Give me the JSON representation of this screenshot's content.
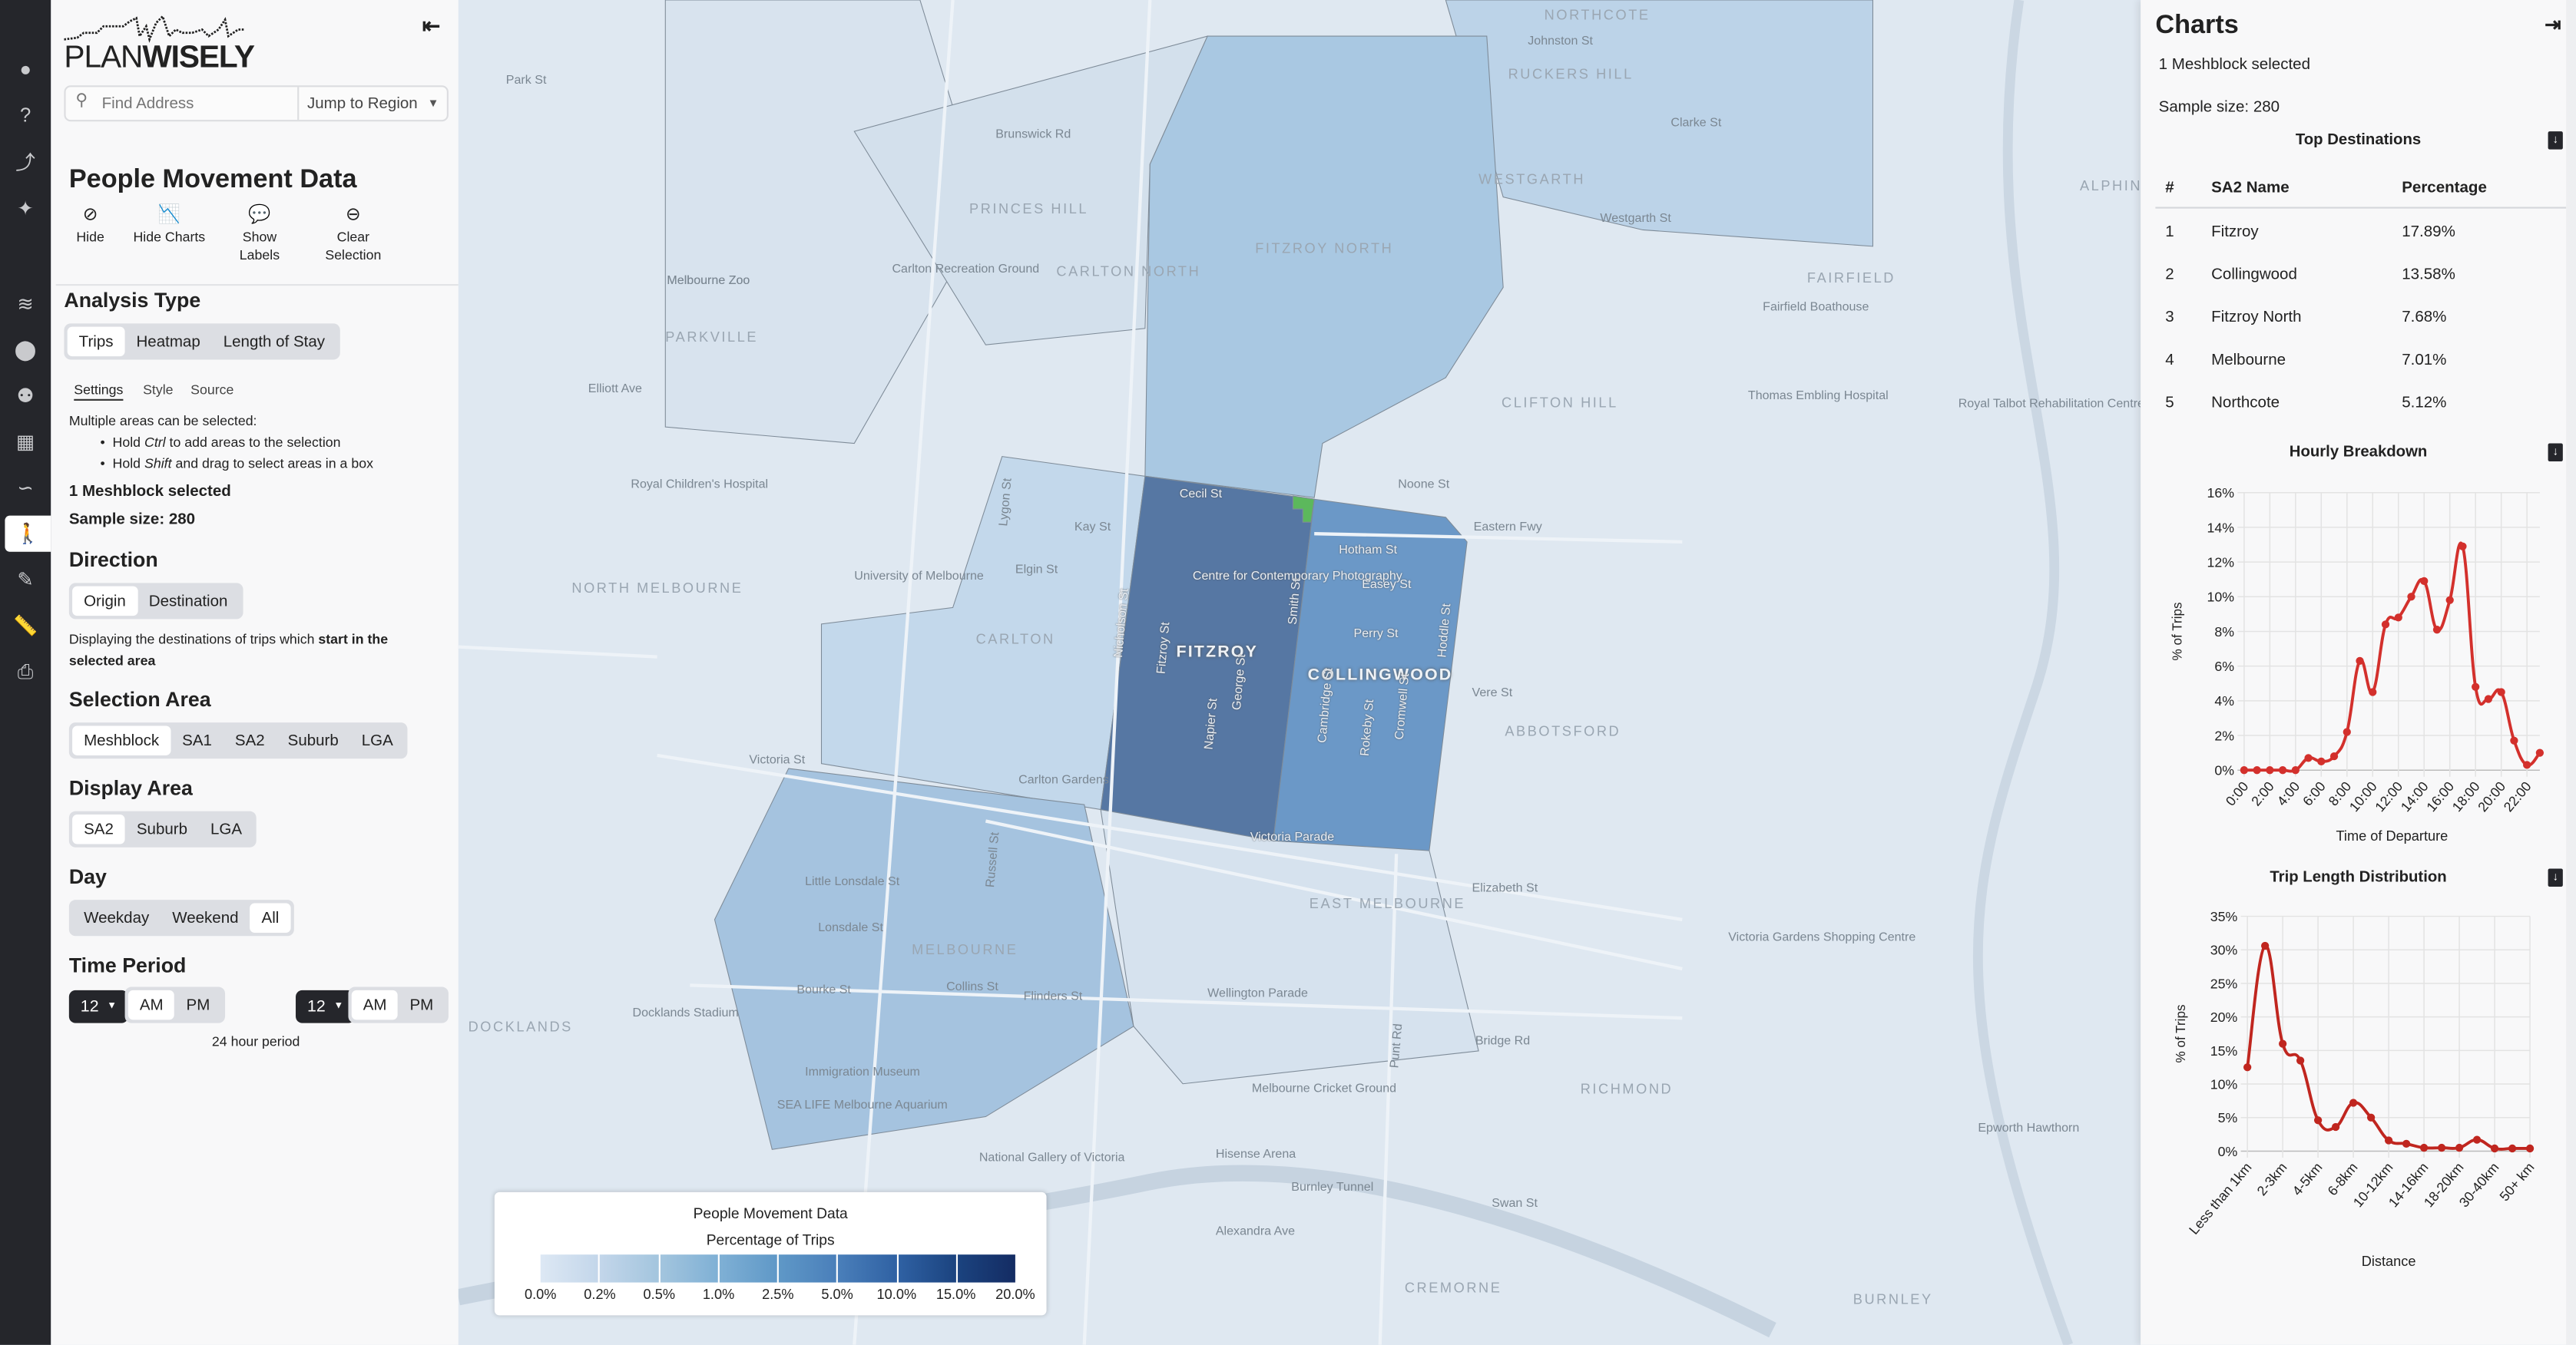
{
  "sidebar": {
    "items": [
      {
        "icon": "user-icon",
        "glyph": "●"
      },
      {
        "icon": "help-icon",
        "glyph": "?"
      },
      {
        "icon": "share-icon",
        "glyph": "⤴"
      },
      {
        "icon": "sparkles-icon",
        "glyph": "✦"
      },
      {
        "icon": "layers-icon",
        "glyph": "≋"
      },
      {
        "icon": "map-pin-icon",
        "glyph": "⬤"
      },
      {
        "icon": "users-icon",
        "glyph": "⚉"
      },
      {
        "icon": "map-location-icon",
        "glyph": "▦"
      },
      {
        "icon": "route-icon",
        "glyph": "∽"
      },
      {
        "icon": "walking-person-icon",
        "glyph": "🚶"
      },
      {
        "icon": "pencil-icon",
        "glyph": "✎"
      },
      {
        "icon": "ruler-icon",
        "glyph": "📏"
      },
      {
        "icon": "print-icon",
        "glyph": "⎙"
      }
    ],
    "active_index": 9
  },
  "logo": {
    "text_light": "PLAN",
    "text_bold": "WISELY"
  },
  "search": {
    "placeholder": "Find Address",
    "jump_label": "Jump to Region"
  },
  "panel": {
    "title": "People Movement Data",
    "actions": [
      {
        "label": "Hide",
        "icon": "eye-slash-icon"
      },
      {
        "label": "Hide Charts",
        "icon": "chart-area-icon"
      },
      {
        "label": "Show Labels",
        "icon": "comment-icon"
      },
      {
        "label": "Clear Selection",
        "icon": "minus-circle-icon"
      }
    ],
    "analysis_type": {
      "heading": "Analysis Type",
      "options": [
        "Trips",
        "Heatmap",
        "Length of Stay"
      ],
      "selected": "Trips"
    },
    "subtabs": {
      "options": [
        "Settings",
        "Style",
        "Source"
      ],
      "selected": "Settings"
    },
    "help": {
      "intro": "Multiple areas can be selected:",
      "b1_pre": "Hold ",
      "b1_key": "Ctrl",
      "b1_post": " to add areas to the selection",
      "b2_pre": "Hold ",
      "b2_key": "Shift",
      "b2_post": " and drag to select areas in a box"
    },
    "selected_count": "1 Meshblock selected",
    "sample_size": "Sample size: 280",
    "direction": {
      "heading": "Direction",
      "options": [
        "Origin",
        "Destination"
      ],
      "selected": "Origin",
      "desc_pre": "Displaying the destinations of trips which ",
      "desc_bold": "start in the selected area"
    },
    "selection_area": {
      "heading": "Selection Area",
      "options": [
        "Meshblock",
        "SA1",
        "SA2",
        "Suburb",
        "LGA"
      ],
      "selected": "Meshblock"
    },
    "display_area": {
      "heading": "Display Area",
      "options": [
        "SA2",
        "Suburb",
        "LGA"
      ],
      "selected": "SA2"
    },
    "day": {
      "heading": "Day",
      "options": [
        "Weekday",
        "Weekend",
        "All"
      ],
      "selected": "All"
    },
    "time_period": {
      "heading": "Time Period",
      "start_hour": "12",
      "start_ampm": "AM",
      "end_hour": "12",
      "end_ampm": "AM",
      "am": "AM",
      "pm": "PM",
      "note": "24 hour period"
    }
  },
  "map": {
    "labels": [
      "FITZROY",
      "COLLINGWOOD",
      "FITZROY NORTH",
      "CARLTON",
      "CARLTON NORTH",
      "PRINCES HILL",
      "PARKVILLE",
      "NORTH MELBOURNE",
      "MELBOURNE",
      "EAST MELBOURNE",
      "ABBOTSFORD",
      "CLIFTON HILL",
      "RICHMOND",
      "CREMORNE",
      "BURNLEY",
      "NORTHCOTE",
      "RUCKERS HILL",
      "WESTGARTH",
      "FAIRFIELD",
      "ALPHINGTON",
      "DOCKLANDS",
      "Cecil St",
      "Centre for Contemporary Photography",
      "Hotham St",
      "Easey St",
      "Perry St",
      "Smith St",
      "Nicholson St",
      "Fitzroy St",
      "George St",
      "Napier St",
      "Cambridge St",
      "Rokeby St",
      "Cromwell St",
      "Hoddle St",
      "Victoria Parade",
      "Carlton Gardens",
      "Elgin St",
      "Kay St",
      "Lygon St",
      "Noone St",
      "Eastern Fwy",
      "Vere St",
      "Victoria St",
      "Elizabeth St",
      "Wellington Parade",
      "Melbourne Zoo",
      "Royal Children's Hospital",
      "University of Melbourne",
      "Carlton Recreation Ground",
      "Melbourne Cricket Ground",
      "Docklands Stadium",
      "Immigration Museum",
      "SEA LIFE Melbourne Aquarium",
      "National Gallery of Victoria",
      "Hisense Arena",
      "Burnley Tunnel",
      "Swan St",
      "Bridge Rd",
      "Victoria Gardens Shopping Centre",
      "Thomas Embling Hospital",
      "Royal Talbot Rehabilitation Centre",
      "Fairfield Boathouse",
      "Epworth Hawthorn",
      "Brunswick Rd",
      "Park St",
      "Elliott Ave",
      "Flinders St",
      "Collins St",
      "Bourke St",
      "Lonsdale St",
      "Little Lonsdale St",
      "Russell St",
      "Alexandra Ave",
      "Punt Rd",
      "Johnston St",
      "Westgarth St",
      "Clarke St",
      "Melbourne Zoo"
    ],
    "colors": {
      "base": "#dfe8f1",
      "fitzroy": "#5677a3",
      "collingwood": "#6b98c7",
      "fitzroy_north": "#a9c8e2",
      "melbourne": "#a5c3df",
      "carlton": "#c3d8eb",
      "northcote": "#bcd3e8",
      "selected": "#5cb85c"
    }
  },
  "legend": {
    "title": "People Movement Data",
    "subtitle": "Percentage of Trips",
    "stops": [
      "0.0%",
      "0.2%",
      "0.5%",
      "1.0%",
      "2.5%",
      "5.0%",
      "10.0%",
      "15.0%",
      "20.0%"
    ],
    "colors": [
      "#dde8f4",
      "#c3d6ea",
      "#a3c5de",
      "#7fb0d5",
      "#5f98c7",
      "#4a7fba",
      "#2f61a3",
      "#1b437f",
      "#142c63"
    ]
  },
  "charts_panel": {
    "title": "Charts",
    "selected_count": "1 Meshblock selected",
    "sample_size": "Sample size: 280",
    "top_destinations": {
      "title": "Top Destinations",
      "columns": [
        "#",
        "SA2 Name",
        "Percentage"
      ],
      "rows": [
        [
          "1",
          "Fitzroy",
          "17.89%"
        ],
        [
          "2",
          "Collingwood",
          "13.58%"
        ],
        [
          "3",
          "Fitzroy North",
          "7.68%"
        ],
        [
          "4",
          "Melbourne",
          "7.01%"
        ],
        [
          "5",
          "Northcote",
          "5.12%"
        ]
      ]
    }
  },
  "chart_data": [
    {
      "type": "line",
      "title": "Hourly Breakdown",
      "xlabel": "Time of Departure",
      "ylabel": "% of Trips",
      "color": "#d3302c",
      "x": [
        "0:00",
        "1:00",
        "2:00",
        "3:00",
        "4:00",
        "5:00",
        "6:00",
        "7:00",
        "8:00",
        "9:00",
        "10:00",
        "11:00",
        "12:00",
        "13:00",
        "14:00",
        "15:00",
        "16:00",
        "17:00",
        "18:00",
        "19:00",
        "20:00",
        "21:00",
        "22:00",
        "23:00"
      ],
      "tick_labels": [
        "0:00",
        "2:00",
        "4:00",
        "6:00",
        "8:00",
        "10:00",
        "12:00",
        "14:00",
        "16:00",
        "18:00",
        "20:00",
        "22:00"
      ],
      "values": [
        0,
        0,
        0,
        0,
        0,
        0.7,
        0.5,
        0.8,
        2.2,
        6.3,
        4.5,
        8.4,
        8.8,
        10.0,
        10.9,
        8.1,
        9.8,
        12.9,
        4.8,
        4.1,
        4.5,
        1.7,
        0.3,
        1.0
      ],
      "ylim": [
        0,
        16
      ],
      "yticks": [
        "0%",
        "2%",
        "4%",
        "6%",
        "8%",
        "10%",
        "12%",
        "14%",
        "16%"
      ],
      "grid": true
    },
    {
      "type": "line",
      "title": "Trip Length Distribution",
      "xlabel": "Distance",
      "ylabel": "% of Trips",
      "color": "#c0261f",
      "x": [
        "Less than 1km",
        "1-2km",
        "2-3km",
        "3-4km",
        "4-5km",
        "5-6km",
        "6-8km",
        "8-10km",
        "10-12km",
        "12-14km",
        "14-16km",
        "16-18km",
        "18-20km",
        "20-30km",
        "30-40km",
        "40-50km",
        "50+ km"
      ],
      "tick_labels": [
        "Less than 1km",
        "2-3km",
        "4-5km",
        "6-8km",
        "10-12km",
        "14-16km",
        "18-20km",
        "30-40km",
        "50+ km"
      ],
      "values": [
        12.5,
        30.6,
        16.0,
        13.5,
        4.6,
        3.6,
        7.2,
        5.0,
        1.6,
        1.1,
        0.5,
        0.5,
        0.5,
        1.7,
        0.4,
        0.4,
        0.4
      ],
      "ylim": [
        0,
        35
      ],
      "yticks": [
        "0%",
        "5%",
        "10%",
        "15%",
        "20%",
        "25%",
        "30%",
        "35%"
      ],
      "grid": true
    }
  ]
}
